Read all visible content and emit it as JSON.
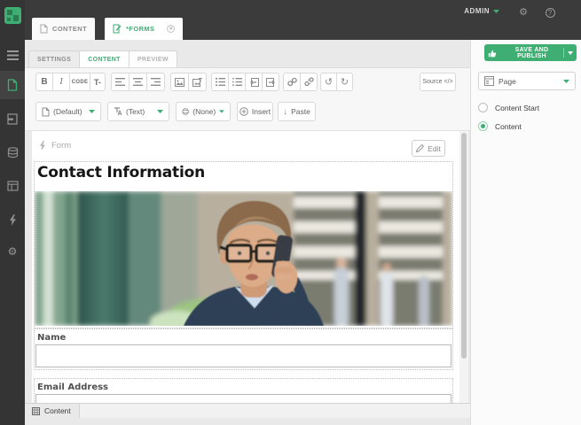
{
  "topbar": {
    "user_label": "ADMIN"
  },
  "icons": {
    "gear": "⚙",
    "help": "?",
    "undo": "↺",
    "redo": "↻",
    "paste_arrow": "↓"
  },
  "main_tabs": [
    {
      "label": "CONTENT"
    },
    {
      "label": "*FORMS"
    }
  ],
  "editor_tabs": [
    {
      "label": "SETTINGS"
    },
    {
      "label": "CONTENT"
    },
    {
      "label": "PREVIEW"
    }
  ],
  "toolbar": {
    "bold": "B",
    "italic": "I",
    "code": "CODE",
    "text_format": "T-",
    "source": "Source",
    "source_glyph": "</>",
    "style_dropdown": "(Default)",
    "text_dropdown": "(Text)",
    "none_dropdown": "(None)",
    "insert": "Insert",
    "paste": "Paste"
  },
  "actions": {
    "save_and_publish": "SAVE AND PUBLISH"
  },
  "right_panel": {
    "page_dropdown": "Page",
    "placements": [
      {
        "label": "Content Start",
        "selected": false
      },
      {
        "label": "Content",
        "selected": true
      }
    ]
  },
  "canvas": {
    "widget_label": "Form",
    "edit_button": "Edit",
    "form_title": "Contact Information",
    "fields": [
      {
        "label": "Name"
      },
      {
        "label": "Email Address"
      }
    ]
  },
  "statusbar": {
    "path_item": "Content"
  },
  "colors": {
    "accent": "#3fae73",
    "topbar": "#3b3b3b"
  }
}
